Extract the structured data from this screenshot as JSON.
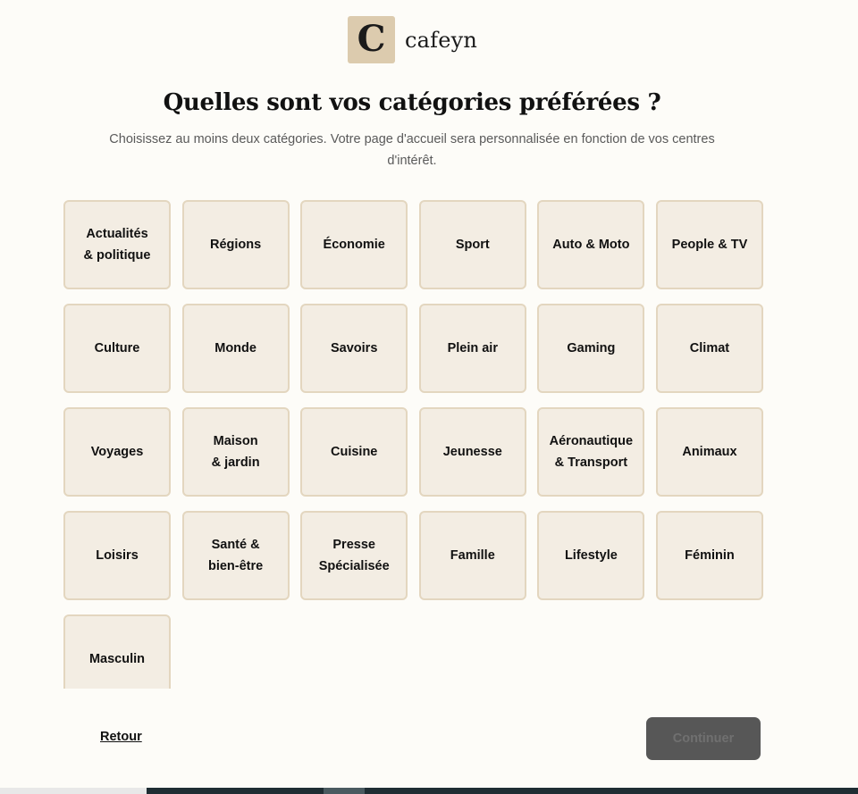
{
  "brand": {
    "mark": "C",
    "name": "cafeyn"
  },
  "heading": {
    "title": "Quelles sont vos catégories préférées ?",
    "subtitle": "Choisissez au moins deux catégories. Votre page d'accueil sera personnalisée en fonction de vos centres d'intérêt."
  },
  "categories": [
    {
      "key": "actualites-politique",
      "label": "Actualités\n& politique"
    },
    {
      "key": "regions",
      "label": "Régions"
    },
    {
      "key": "economie",
      "label": "Économie"
    },
    {
      "key": "sport",
      "label": "Sport"
    },
    {
      "key": "auto-moto",
      "label": "Auto & Moto"
    },
    {
      "key": "people-tv",
      "label": "People & TV"
    },
    {
      "key": "culture",
      "label": "Culture"
    },
    {
      "key": "monde",
      "label": "Monde"
    },
    {
      "key": "savoirs",
      "label": "Savoirs"
    },
    {
      "key": "plein-air",
      "label": "Plein air"
    },
    {
      "key": "gaming",
      "label": "Gaming"
    },
    {
      "key": "climat",
      "label": "Climat"
    },
    {
      "key": "voyages",
      "label": "Voyages"
    },
    {
      "key": "maison-jardin",
      "label": "Maison\n& jardin"
    },
    {
      "key": "cuisine",
      "label": "Cuisine"
    },
    {
      "key": "jeunesse",
      "label": "Jeunesse"
    },
    {
      "key": "aeronautique-transport",
      "label": "Aéronautique\n& Transport"
    },
    {
      "key": "animaux",
      "label": "Animaux"
    },
    {
      "key": "loisirs",
      "label": "Loisirs"
    },
    {
      "key": "sante-bien-etre",
      "label": "Santé &\nbien-être"
    },
    {
      "key": "presse-specialisee",
      "label": "Presse\nSpécialisée"
    },
    {
      "key": "famille",
      "label": "Famille"
    },
    {
      "key": "lifestyle",
      "label": "Lifestyle"
    },
    {
      "key": "feminin",
      "label": "Féminin"
    },
    {
      "key": "masculin",
      "label": "Masculin"
    }
  ],
  "footer": {
    "back_label": "Retour",
    "continue_label": "Continuer"
  },
  "colors": {
    "background": "#fdfcf8",
    "tile_bg": "#f3ede3",
    "tile_border": "#e3d6bf",
    "logo_bg": "#dccbae",
    "button_disabled_bg": "#575757"
  }
}
